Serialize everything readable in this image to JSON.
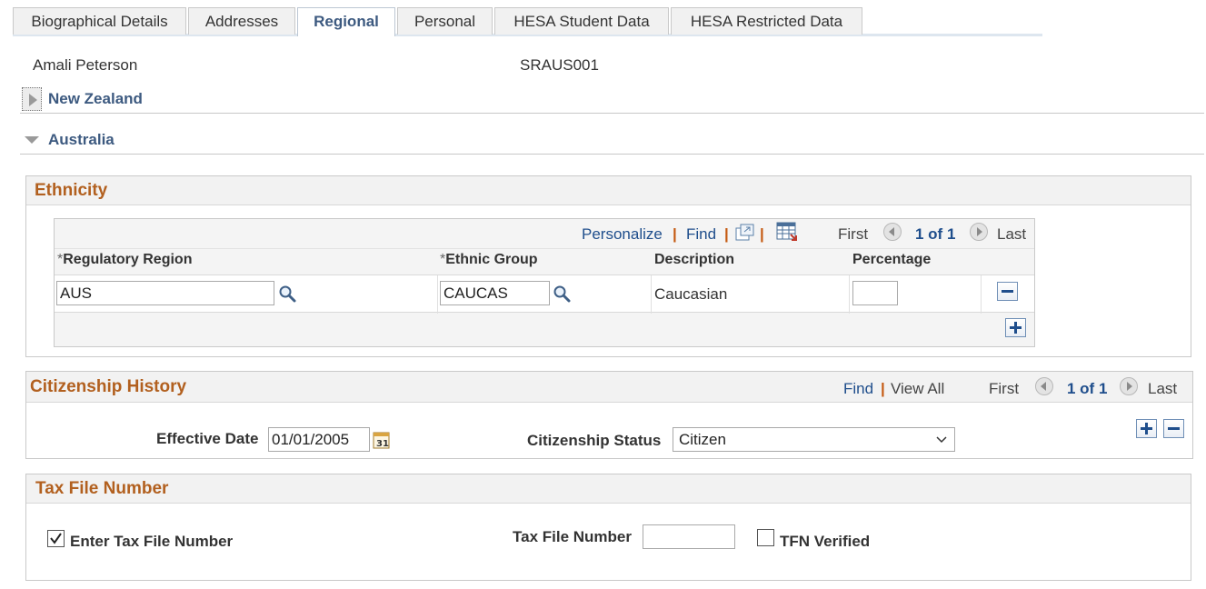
{
  "tabs": [
    {
      "label": "Biographical Details",
      "active": false
    },
    {
      "label": "Addresses",
      "active": false
    },
    {
      "label": "Regional",
      "active": true
    },
    {
      "label": "Personal",
      "active": false
    },
    {
      "label": "HESA Student Data",
      "active": false
    },
    {
      "label": "HESA Restricted Data",
      "active": false
    }
  ],
  "student": {
    "name": "Amali Peterson",
    "id": "SRAUS001"
  },
  "sections": {
    "new_zealand": {
      "label": "New Zealand",
      "state": "collapsed"
    },
    "australia": {
      "label": "Australia",
      "state": "expanded"
    }
  },
  "ethnicity": {
    "title": "Ethnicity",
    "nav": {
      "personalize": "Personalize",
      "find": "Find",
      "first": "First",
      "count": "1 of 1",
      "last": "Last"
    },
    "columns": {
      "required_marker": "*",
      "regulatory_region": "Regulatory Region",
      "ethnic_group": "Ethnic Group",
      "description": "Description",
      "percentage": "Percentage"
    },
    "rows": [
      {
        "regulatory_region": "AUS",
        "ethnic_group": "CAUCAS",
        "description": "Caucasian",
        "percentage": ""
      }
    ]
  },
  "citizenship": {
    "title": "Citizenship History",
    "nav": {
      "find": "Find",
      "view_all": "View All",
      "first": "First",
      "count": "1 of 1",
      "last": "Last"
    },
    "effective_date_label": "Effective Date",
    "effective_date": "01/01/2005",
    "status_label": "Citizenship Status",
    "status": "Citizen"
  },
  "tax": {
    "title": "Tax File Number",
    "enter_label": "Enter Tax File Number",
    "enter_checked": true,
    "tfn_label": "Tax File Number",
    "tfn_value": "",
    "verified_label": "TFN Verified",
    "verified_checked": false
  },
  "icons": {
    "lookup": "magnifier-icon",
    "calendar": "calendar-icon",
    "zoom": "new-window-icon",
    "download": "spreadsheet-download-icon"
  }
}
